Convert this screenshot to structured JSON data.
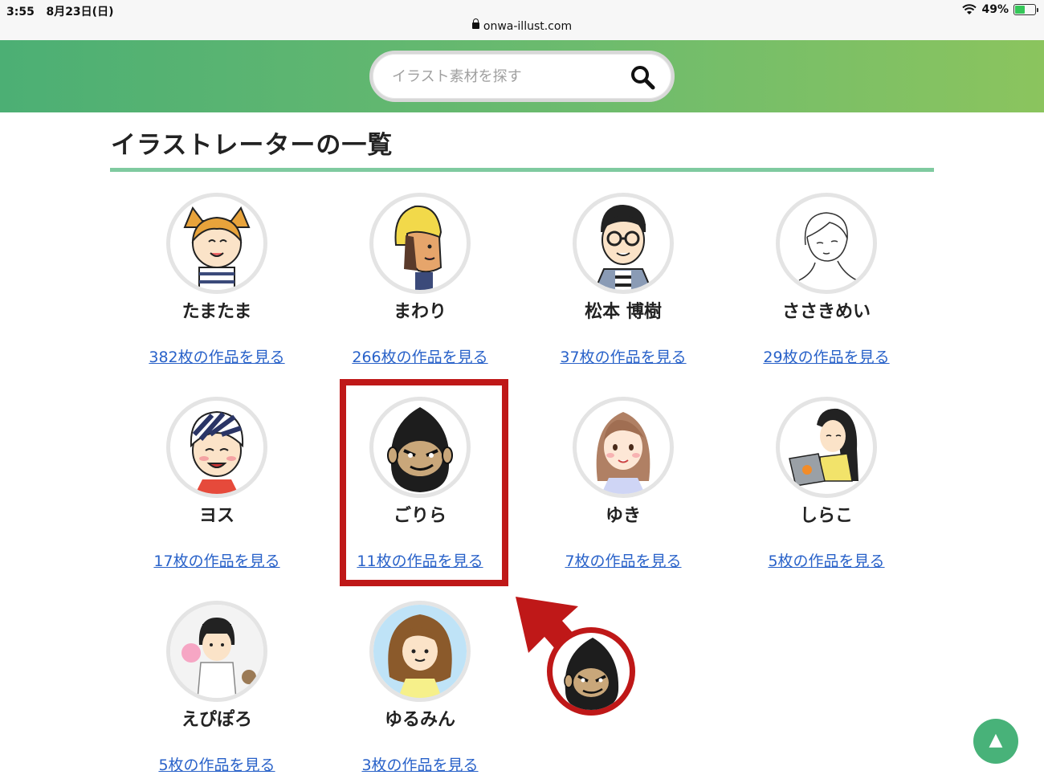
{
  "status_bar": {
    "time": "3:55",
    "date": "8月23日(日)",
    "battery": "49%",
    "battery_level": 0.49
  },
  "url": "onwa-illust.com",
  "search": {
    "placeholder": "イラスト素材を探す"
  },
  "page": {
    "title": "イラストレーターの一覧"
  },
  "artists": [
    {
      "name": "たまたま",
      "link": "382枚の作品を見る"
    },
    {
      "name": "まわり",
      "link": "266枚の作品を見る"
    },
    {
      "name": "松本 博樹",
      "link": "37枚の作品を見る"
    },
    {
      "name": "ささきめい",
      "link": "29枚の作品を見る"
    },
    {
      "name": "ヨス",
      "link": "17枚の作品を見る"
    },
    {
      "name": "ごりら",
      "link": "11枚の作品を見る"
    },
    {
      "name": "ゆき",
      "link": "7枚の作品を見る"
    },
    {
      "name": "しらこ",
      "link": "5枚の作品を見る"
    },
    {
      "name": "えぴぽろ",
      "link": "5枚の作品を見る"
    },
    {
      "name": "ゆるみん",
      "link": "3枚の作品を見る"
    }
  ],
  "scroll_top": {
    "label": "▲"
  },
  "colors": {
    "header_start": "#4caf74",
    "header_end": "#8bc45e",
    "accent_rule": "#7fcaa0",
    "link": "#2962c9",
    "highlight": "#bf1818"
  }
}
